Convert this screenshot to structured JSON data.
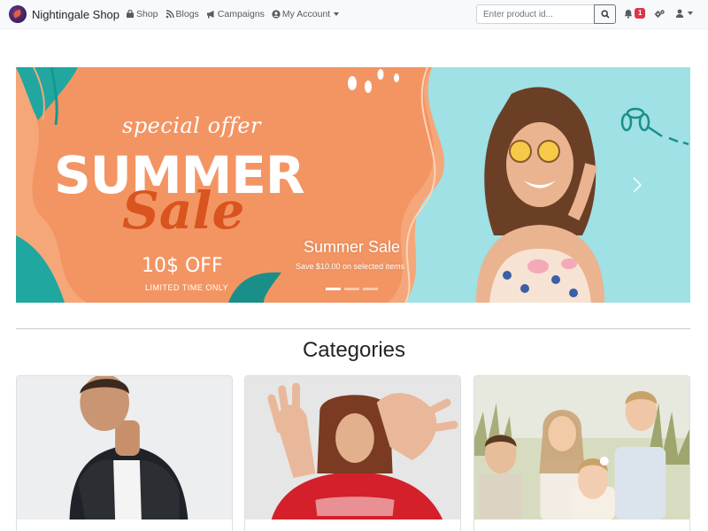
{
  "navbar": {
    "brand": "Nightingale Shop",
    "links": [
      {
        "label": "Shop",
        "icon": "bag-icon"
      },
      {
        "label": "Blogs",
        "icon": "blog-icon"
      },
      {
        "label": "Campaigns",
        "icon": "megaphone-icon"
      },
      {
        "label": "My Account",
        "icon": "user-circle-icon"
      }
    ],
    "search_placeholder": "Enter product id...",
    "notifications_count": "1"
  },
  "carousel": {
    "banner": {
      "special": "special offer",
      "summer": "SUMMER",
      "sale": "Sale",
      "off": "10$ OFF",
      "limited": "LIMITED TIME ONLY"
    },
    "caption_title": "Summer Sale",
    "caption_subtitle": "Save $10.00 on selected items",
    "slide_count": 3,
    "active_slide": 1
  },
  "categories": {
    "title": "Categories",
    "cards": [
      {
        "subject": "men"
      },
      {
        "subject": "women"
      },
      {
        "subject": "kids"
      }
    ]
  },
  "colors": {
    "navbar_bg": "#f8f9fa",
    "badge": "#dc3545",
    "banner_orange": "#f5a77a",
    "banner_teal": "#9fe1e4",
    "sale_text": "#d9541e"
  }
}
